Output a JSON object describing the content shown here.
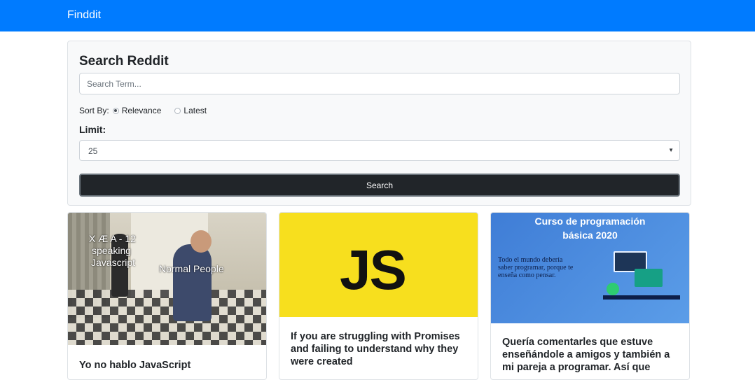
{
  "navbar": {
    "brand": "Finddit"
  },
  "search": {
    "title": "Search Reddit",
    "placeholder": "Search Term...",
    "sort_label": "Sort By:",
    "sort_options": [
      "Relevance",
      "Latest"
    ],
    "sort_selected": "Relevance",
    "limit_label": "Limit:",
    "limit_value": "25",
    "button_label": "Search"
  },
  "cards": [
    {
      "title": "Yo no hablo JavaScript",
      "image_text": [
        "X Æ A - 12",
        "speaking",
        "Javascript",
        "Normal People"
      ]
    },
    {
      "title": "If you are struggling with Promises and failing to understand why they were created",
      "image_text": [
        "JS"
      ]
    },
    {
      "title": "Quería comentarles que estuve enseñándole a amigos y también a mi pareja a programar. Así que",
      "image_text": [
        "Curso de programación",
        "básica 2020",
        "Todo el mundo debería saber programar, porque te enseña como pensar."
      ]
    }
  ],
  "colors": {
    "navbar": "#007bff",
    "button": "#212529",
    "js_yellow": "#f7df1e"
  }
}
